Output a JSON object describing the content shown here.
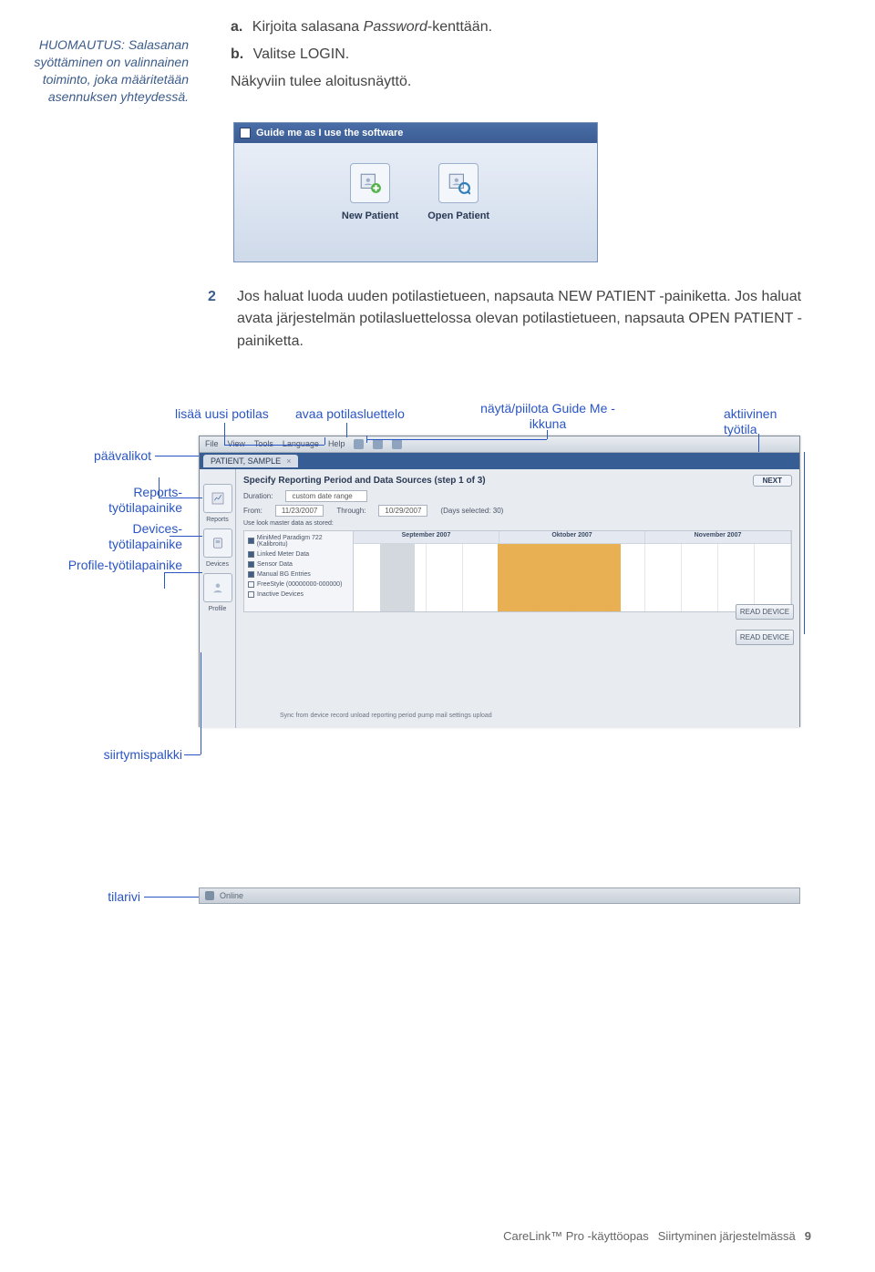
{
  "note": "HUOMAUTUS: Salasanan syöttäminen on valinnainen toiminto, joka määritetään asennuksen yhteydessä.",
  "steps": {
    "a_label": "a.",
    "a_text1": "Kirjoita salasana ",
    "a_italic": "Password",
    "a_text2": "-kenttään.",
    "b_label": "b.",
    "b_text": "Valitse LOGIN.",
    "b_sub": "Näkyviin tulee aloitusnäyttö."
  },
  "shot1": {
    "bar": "Guide me as I use the software",
    "new": "New Patient",
    "open": "Open Patient"
  },
  "para2": {
    "n": "2",
    "text": "Jos haluat luoda uuden potilastietueen, napsauta NEW PATIENT -painiketta. Jos haluat avata järjestelmän potilasluettelossa olevan potilastietueen, napsauta OPEN PATIENT -painiketta."
  },
  "ann": {
    "add": "lisää uusi potilas",
    "openlist": "avaa potilasluettelo",
    "guide": "näytä/piilota Guide Me -ikkuna",
    "active": "aktiivinen työtila",
    "menus": "päävalikot",
    "reports": "Reports-työtilapainike",
    "devices": "Devices-työtilapainike",
    "profile": "Profile-työtilapainike",
    "navbar": "siirtymispalkki",
    "statusrow": "tilarivi"
  },
  "shot2": {
    "menu_items": [
      "File",
      "View",
      "Tools",
      "Language",
      "Help"
    ],
    "tab": "PATIENT, SAMPLE",
    "left": {
      "reports": "Reports",
      "devices": "Devices",
      "profile": "Profile"
    },
    "heading": "Specify Reporting Period and Data Sources (step 1 of 3)",
    "next": "NEXT",
    "from_lbl": "Duration:",
    "from_val": "custom date range",
    "date_from": "From:",
    "date_from_v": "11/23/2007",
    "date_to": "Through:",
    "date_to_v": "10/29/2007",
    "days": "(Days selected: 30)",
    "listtip": "Use look master data as stored:",
    "months": {
      "m1": "September 2007",
      "m2": "Oktober 2007",
      "m3": "November 2007"
    },
    "list": [
      "MiniMed Paradigm 722 (Kalibroitu)",
      "Linked Meter Data",
      "Sensor Data",
      "Manual BG Entries",
      "FreeStyle (00000000-000000)",
      "Inactive Devices"
    ],
    "readdev": "READ DEVICE",
    "footnote": "Sync from device record   unload reporting period   pump mail settings upload",
    "status": "Online"
  },
  "footer": {
    "guide": "CareLink™ Pro -käyttöopas",
    "section": "Siirtyminen järjestelmässä",
    "page": "9"
  }
}
